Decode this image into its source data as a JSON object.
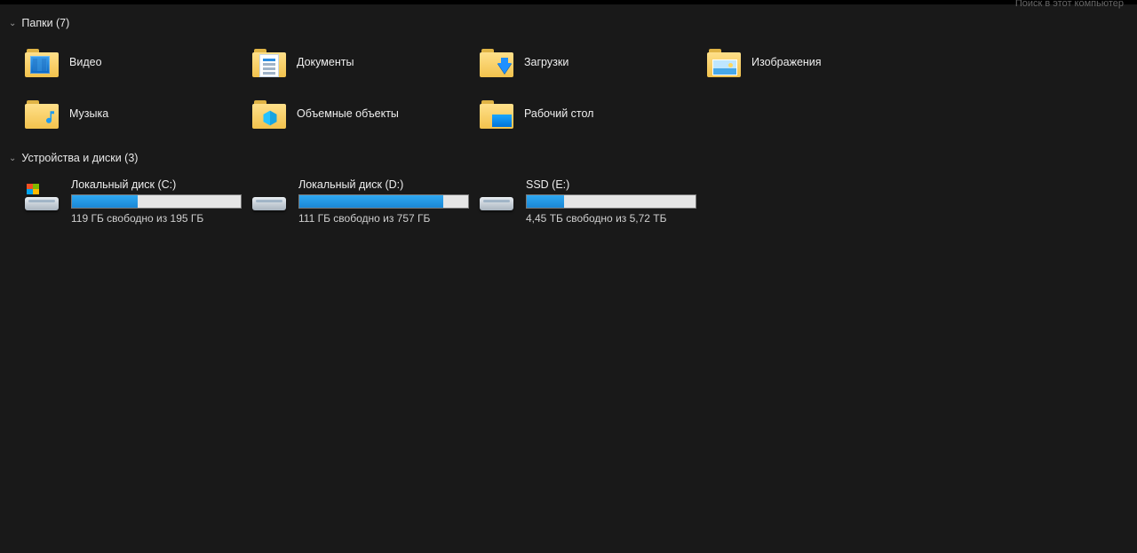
{
  "search_placeholder": "Поиск в этот компьютер",
  "groups": {
    "folders": {
      "title": "Папки (7)",
      "items": [
        {
          "label": "Видео",
          "icon": "video"
        },
        {
          "label": "Документы",
          "icon": "documents"
        },
        {
          "label": "Загрузки",
          "icon": "downloads"
        },
        {
          "label": "Изображения",
          "icon": "pictures"
        },
        {
          "label": "Музыка",
          "icon": "music"
        },
        {
          "label": "Объемные объекты",
          "icon": "3d"
        },
        {
          "label": "Рабочий стол",
          "icon": "desktop"
        }
      ]
    },
    "drives": {
      "title": "Устройства и диски (3)",
      "items": [
        {
          "name": "Локальный диск (C:)",
          "free": "119 ГБ свободно из 195 ГБ",
          "fill_pct": 39,
          "os": true
        },
        {
          "name": "Локальный диск (D:)",
          "free": "111 ГБ свободно из 757 ГБ",
          "fill_pct": 85,
          "os": false
        },
        {
          "name": "SSD (E:)",
          "free": "4,45 ТБ свободно из 5,72 ТБ",
          "fill_pct": 22,
          "os": false
        }
      ]
    }
  }
}
